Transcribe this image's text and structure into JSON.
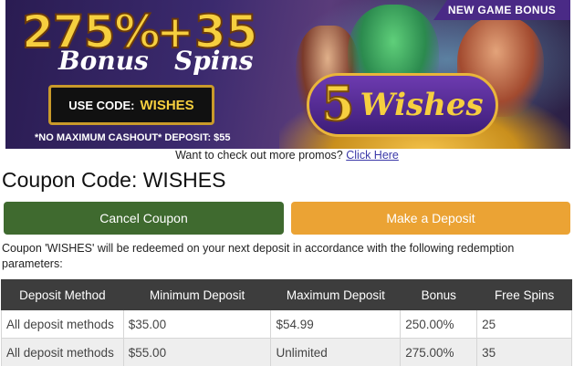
{
  "banner": {
    "ribbon": "NEW GAME BONUS",
    "headline_percent": "275%",
    "headline_plus": "+35",
    "headline_bonus": "Bonus",
    "headline_spins": "Spins",
    "code_label": "USE CODE:",
    "code_value": "WISHES",
    "fineprint": "*NO MAXIMUM CASHOUT* DEPOSIT: $55",
    "logo_number": "5",
    "logo_word": "Wishes"
  },
  "promo": {
    "text": "Want to check out more promos?",
    "link": "Click Here"
  },
  "coupon": {
    "title": "Coupon Code: WISHES"
  },
  "buttons": {
    "cancel": "Cancel Coupon",
    "deposit": "Make a Deposit"
  },
  "colors": {
    "cancel_button": "#3f6a2f",
    "deposit_button": "#eba334",
    "table_header": "#3d3d3d"
  },
  "info": {
    "text": "Coupon 'WISHES' will be redeemed on your next deposit in accordance with the following redemption parameters:"
  },
  "table": {
    "headers": [
      "Deposit Method",
      "Minimum Deposit",
      "Maximum Deposit",
      "Bonus",
      "Free Spins"
    ],
    "rows": [
      [
        "All deposit methods",
        "$35.00",
        "$54.99",
        "250.00%",
        "25"
      ],
      [
        "All deposit methods",
        "$55.00",
        "Unlimited",
        "275.00%",
        "35"
      ]
    ]
  }
}
